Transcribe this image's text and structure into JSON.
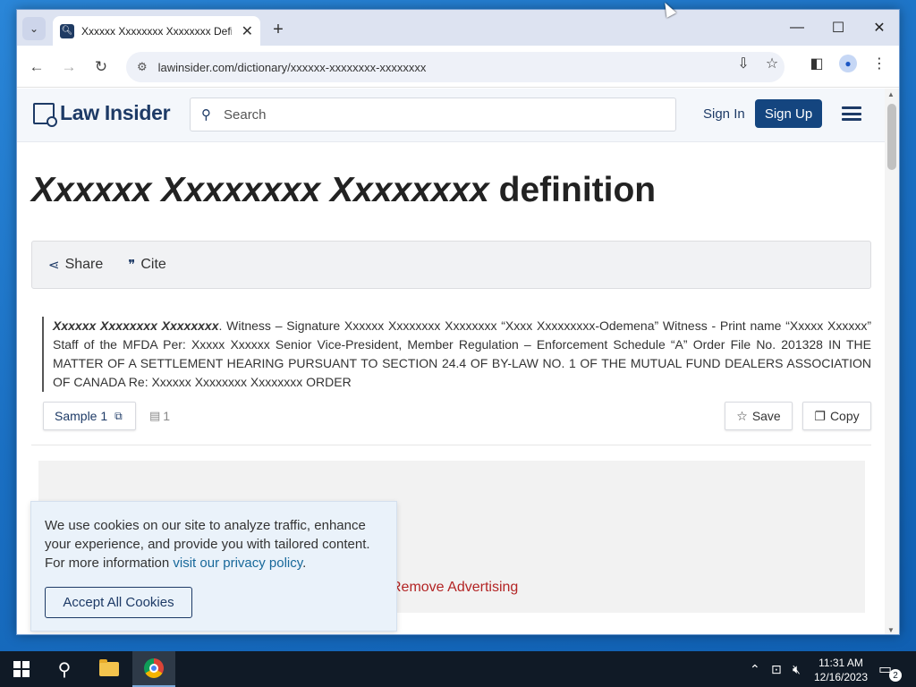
{
  "browser": {
    "tab_title": "Xxxxxx Xxxxxxxx Xxxxxxxx Defin",
    "url": "lawinsider.com/dictionary/xxxxxx-xxxxxxxx-xxxxxxxx",
    "new_tab_symbol": "+",
    "close_tab_symbol": "✕",
    "minimize_symbol": "—",
    "maximize_symbol": "☐",
    "close_window_symbol": "✕"
  },
  "site": {
    "logo_text": "Law Insider",
    "search_placeholder": "Search",
    "sign_in": "Sign In",
    "sign_up": "Sign Up"
  },
  "page": {
    "title_term": "Xxxxxx Xxxxxxxx Xxxxxxxx",
    "title_suffix": " definition",
    "share_label": "Share",
    "cite_label": "Cite",
    "definition_term": "Xxxxxx Xxxxxxxx Xxxxxxxx",
    "definition_text": ". Witness – Signature Xxxxxx Xxxxxxxx Xxxxxxxx “Xxxx Xxxxxxxxx-Odemena” Witness - Print name “Xxxxx Xxxxxx” Staff of the MFDA Per: Xxxxx Xxxxxx Senior Vice-President, Member Regulation – Enforcement Schedule “A” Order File No. 201328 IN THE MATTER OF A SETTLEMENT HEARING PURSUANT TO SECTION 24.4 OF BY-LAW NO. 1 OF THE MUTUAL FUND DEALERS ASSOCIATION OF CANADA Re: Xxxxxx Xxxxxxxx Xxxxxxxx ORDER",
    "sample_label": "Sample 1",
    "doc_count": "1",
    "save_label": "Save",
    "copy_label": "Copy",
    "remove_ads": "Remove Advertising"
  },
  "cookie": {
    "text": "We use cookies on our site to analyze traffic, enhance your experience, and provide you with tailored content. For more information ",
    "link": "visit our privacy policy",
    "period": ".",
    "accept": "Accept All Cookies"
  },
  "taskbar": {
    "time": "11:31 AM",
    "date": "12/16/2023",
    "notification_count": "2"
  },
  "colors": {
    "brand_navy": "#1d3a66",
    "signup_bg": "#14457f",
    "remove_ads_red": "#b32424",
    "cookie_bg": "#eaf2fa"
  }
}
